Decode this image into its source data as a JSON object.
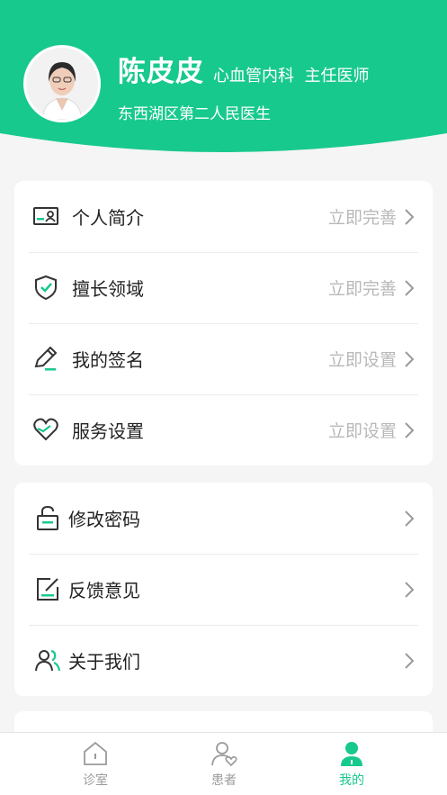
{
  "profile": {
    "name": "陈皮皮",
    "title": "心血管内科  主任医师",
    "hospital": "东西湖区第二人民医生"
  },
  "menu1": [
    {
      "label": "个人简介",
      "value": "立即完善",
      "icon": "profile-card-icon"
    },
    {
      "label": "擅长领域",
      "value": "立即完善",
      "icon": "shield-check-icon"
    },
    {
      "label": "我的签名",
      "value": "立即设置",
      "icon": "pen-icon"
    },
    {
      "label": "服务设置",
      "value": "立即设置",
      "icon": "heart-icon"
    }
  ],
  "menu2": [
    {
      "label": "修改密码",
      "icon": "unlock-icon"
    },
    {
      "label": "反馈意见",
      "icon": "feedback-edit-icon"
    },
    {
      "label": "关于我们",
      "icon": "users-icon"
    }
  ],
  "tabs": [
    {
      "label": "诊室",
      "icon": "home-icon"
    },
    {
      "label": "患者",
      "icon": "patient-icon"
    },
    {
      "label": "我的",
      "icon": "me-icon"
    }
  ],
  "colors": {
    "accent": "#18c98e",
    "background": "#f5f5f5"
  }
}
